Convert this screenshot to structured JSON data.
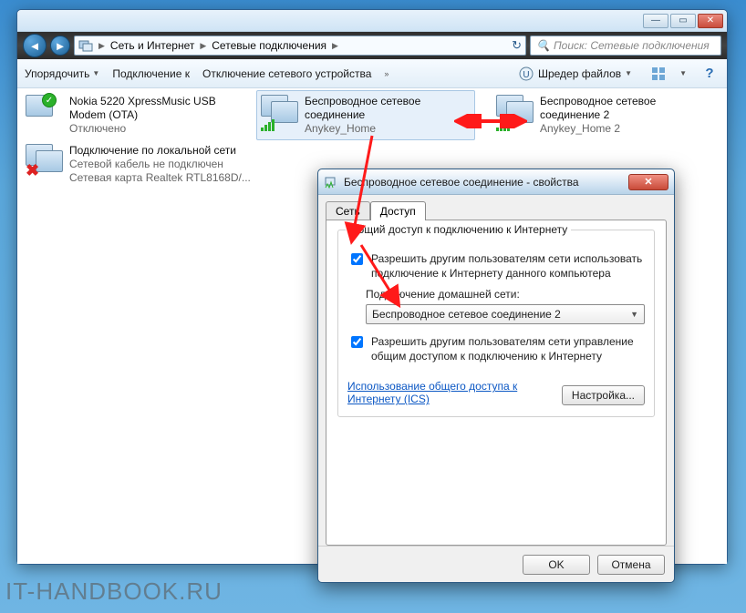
{
  "explorer": {
    "breadcrumb": {
      "item1": "Сеть и Интернет",
      "item2": "Сетевые подключения"
    },
    "search_placeholder": "Поиск: Сетевые подключения",
    "toolbar": {
      "organize": "Упорядочить",
      "connect": "Подключение к",
      "disable": "Отключение сетевого устройства",
      "shredder": "Шредер файлов"
    },
    "items": {
      "nokia": {
        "name": "Nokia 5220 XpressMusic USB Modem (OTA)",
        "status": "Отключено"
      },
      "wifi1": {
        "name": "Беспроводное сетевое соединение",
        "status": "Anykey_Home"
      },
      "wifi2": {
        "name": "Беспроводное сетевое соединение 2",
        "status": "Anykey_Home 2"
      },
      "lan": {
        "name": "Подключение по локальной сети",
        "status": "Сетевой кабель не подключен",
        "device": "Сетевая карта Realtek RTL8168D/..."
      }
    }
  },
  "dialog": {
    "title": "Беспроводное сетевое соединение - свойства",
    "tabs": {
      "network": "Сеть",
      "sharing": "Доступ"
    },
    "group_legend": "Общий доступ к подключению к Интернету",
    "check1": "Разрешить другим пользователям сети использовать подключение к Интернету данного компьютера",
    "home_label": "Подключение домашней сети:",
    "combo_value": "Беспроводное сетевое соединение 2",
    "check2": "Разрешить другим пользователям сети управление общим доступом к подключению к Интернету",
    "link_line1": "Использование общего доступа к",
    "link_line2": "Интернету (ICS)",
    "settings_btn": "Настройка...",
    "ok": "OK",
    "cancel": "Отмена"
  },
  "watermark": "IT-HANDBOOK.RU"
}
